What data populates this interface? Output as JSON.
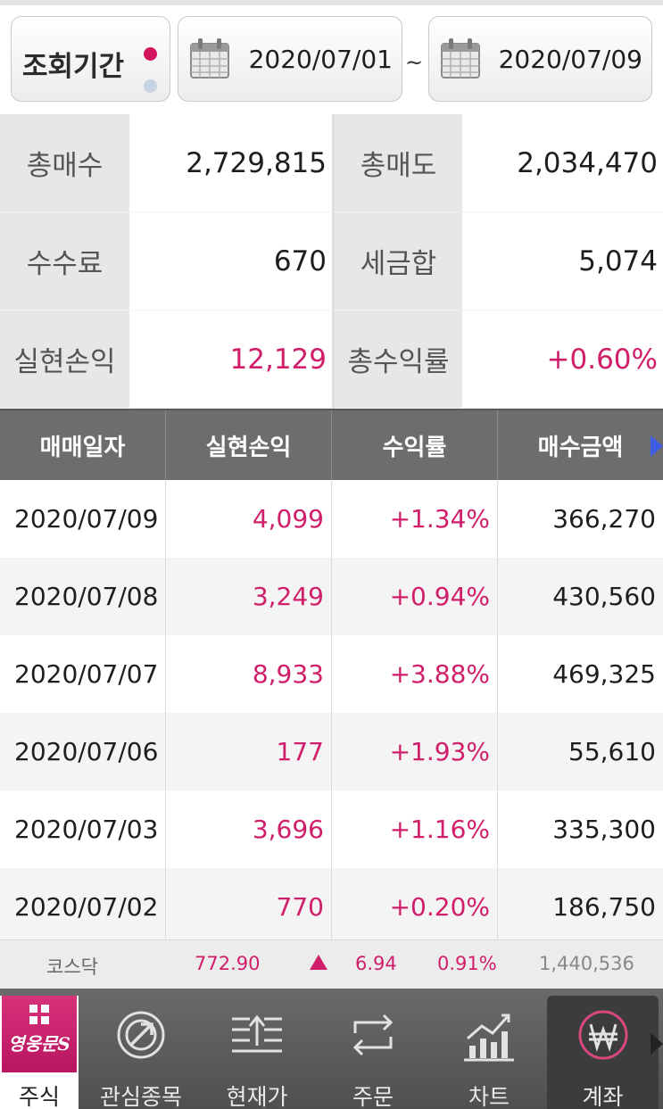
{
  "period": {
    "label": "조회기간",
    "start_date": "2020/07/01",
    "separator": "~",
    "end_date": "2020/07/09"
  },
  "summary": {
    "total_buy_label": "총매수",
    "total_buy": "2,729,815",
    "total_sell_label": "총매도",
    "total_sell": "2,034,470",
    "fee_label": "수수료",
    "fee": "670",
    "tax_label": "세금합",
    "tax": "5,074",
    "realized_pl_label": "실현손익",
    "realized_pl": "12,129",
    "total_return_label": "총수익률",
    "total_return": "+0.60%"
  },
  "table": {
    "headers": [
      "매매일자",
      "실현손익",
      "수익률",
      "매수금액"
    ],
    "rows": [
      {
        "date": "2020/07/09",
        "pl": "4,099",
        "rate": "+1.34%",
        "buy": "366,270"
      },
      {
        "date": "2020/07/08",
        "pl": "3,249",
        "rate": "+0.94%",
        "buy": "430,560"
      },
      {
        "date": "2020/07/07",
        "pl": "8,933",
        "rate": "+3.88%",
        "buy": "469,325"
      },
      {
        "date": "2020/07/06",
        "pl": "177",
        "rate": "+1.93%",
        "buy": "55,610"
      },
      {
        "date": "2020/07/03",
        "pl": "3,696",
        "rate": "+1.16%",
        "buy": "335,300"
      },
      {
        "date": "2020/07/02",
        "pl": "770",
        "rate": "+0.20%",
        "buy": "186,750"
      }
    ]
  },
  "ticker": {
    "name": "코스닥",
    "price": "772.90",
    "change": "6.94",
    "percent": "0.91%",
    "volume": "1,440,536"
  },
  "nav": {
    "brand_text": "영웅문S",
    "items": [
      {
        "label": "주식",
        "icon": "grid-icon"
      },
      {
        "label": "관심종목",
        "icon": "target-arrow-icon"
      },
      {
        "label": "현재가",
        "icon": "price-level-icon"
      },
      {
        "label": "주문",
        "icon": "exchange-arrows-icon"
      },
      {
        "label": "차트",
        "icon": "chart-trend-icon"
      },
      {
        "label": "계좌",
        "icon": "won-coin-icon"
      }
    ]
  },
  "colors": {
    "accent_pink": "#d01e6a",
    "header_gray": "#6d6d6d",
    "nav_bg": "#5c5c5c",
    "brand_pink": "#c81c68"
  }
}
